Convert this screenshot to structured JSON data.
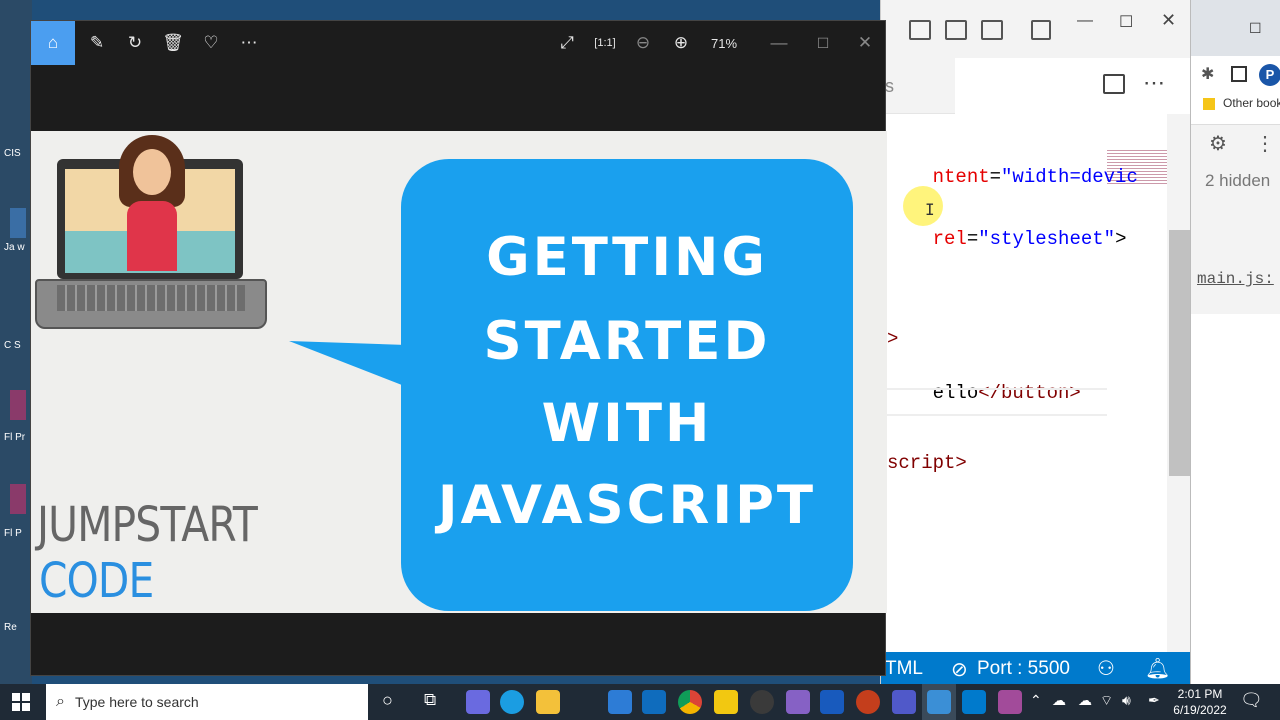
{
  "desktop": {
    "labels": [
      "CIS",
      "Ja w",
      "C S",
      "Fl Pr",
      "Fl P",
      "Re"
    ]
  },
  "photos": {
    "zoom": "71%",
    "slide": {
      "lines": [
        "GETTING",
        "STARTED",
        "WITH",
        "JAVASCRIPT"
      ],
      "brand_line1": "JUMPSTART",
      "brand_line2": "CODE"
    }
  },
  "vscode": {
    "code_lines": [
      {
        "attr": "ntent",
        "eq": "=",
        "val": "\"width=devic"
      },
      {
        "attr": "rel",
        "eq": "=",
        "val": "\"stylesheet\"",
        "tail": ">"
      },
      {
        "plain": ">"
      },
      {
        "text": "ello",
        "tag": "</button>"
      },
      {
        "tag": "script>"
      }
    ],
    "status": {
      "html": "TML",
      "port": "Port : 5500"
    }
  },
  "browser": {
    "bookmark": "Other book",
    "hidden": "2 hidden",
    "link": "main.js:"
  },
  "taskbar": {
    "search_placeholder": "Type here to search",
    "time": "2:01 PM",
    "date": "6/19/2022"
  },
  "colors": {
    "bubble": "#1aa0ee",
    "statusbar": "#007acc",
    "home_active": "#4b9ef0"
  }
}
